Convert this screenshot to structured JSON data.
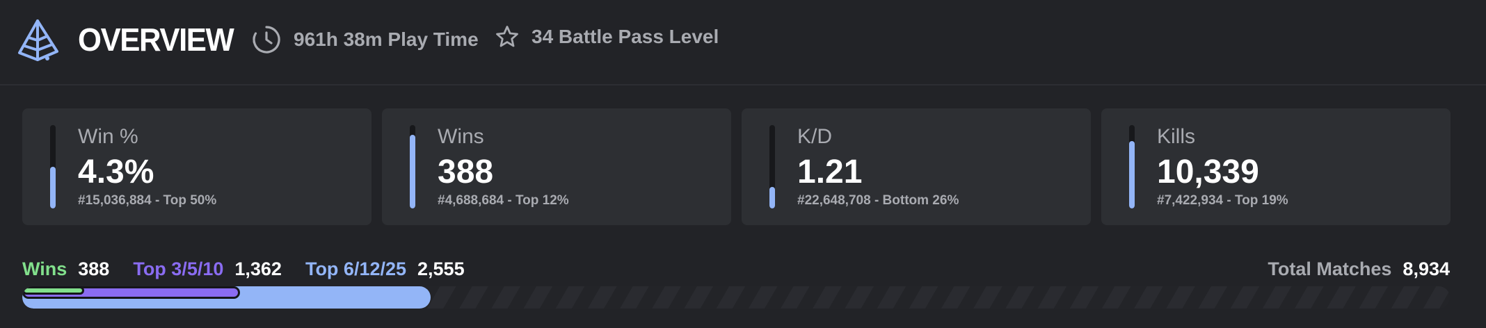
{
  "header": {
    "title": "OVERVIEW",
    "play_time": "961h 38m Play Time",
    "battle_pass": "34 Battle Pass Level",
    "icons": {
      "logo": "pyramid-logo-icon",
      "play_time": "clock-icon",
      "battle_pass": "star-icon"
    }
  },
  "colors": {
    "accent": "#93b5f7",
    "wins": "#82e08c",
    "top10": "#8a6cf2",
    "top25": "#93b5f7",
    "muted": "#a9abb1",
    "card": "#2d2f33",
    "background": "#222327"
  },
  "cards": [
    {
      "label": "Win %",
      "value": "4.3%",
      "rank": "#15,036,884 - Top 50%",
      "fill": 0.5
    },
    {
      "label": "Wins",
      "value": "388",
      "rank": "#4,688,684 - Top 12%",
      "fill": 0.88
    },
    {
      "label": "K/D",
      "value": "1.21",
      "rank": "#22,648,708 - Bottom 26%",
      "fill": 0.26
    },
    {
      "label": "Kills",
      "value": "10,339",
      "rank": "#7,422,934 - Top 19%",
      "fill": 0.81
    }
  ],
  "placements": {
    "wins": {
      "label": "Wins",
      "value": "388"
    },
    "top10": {
      "label": "Top 3/5/10",
      "value": "1,362"
    },
    "top25": {
      "label": "Top 6/12/25",
      "value": "2,555"
    },
    "total": {
      "label": "Total Matches",
      "value": "8,934"
    },
    "fractions": {
      "wins": 0.0434,
      "top10": 0.1524,
      "top25": 0.286
    }
  }
}
